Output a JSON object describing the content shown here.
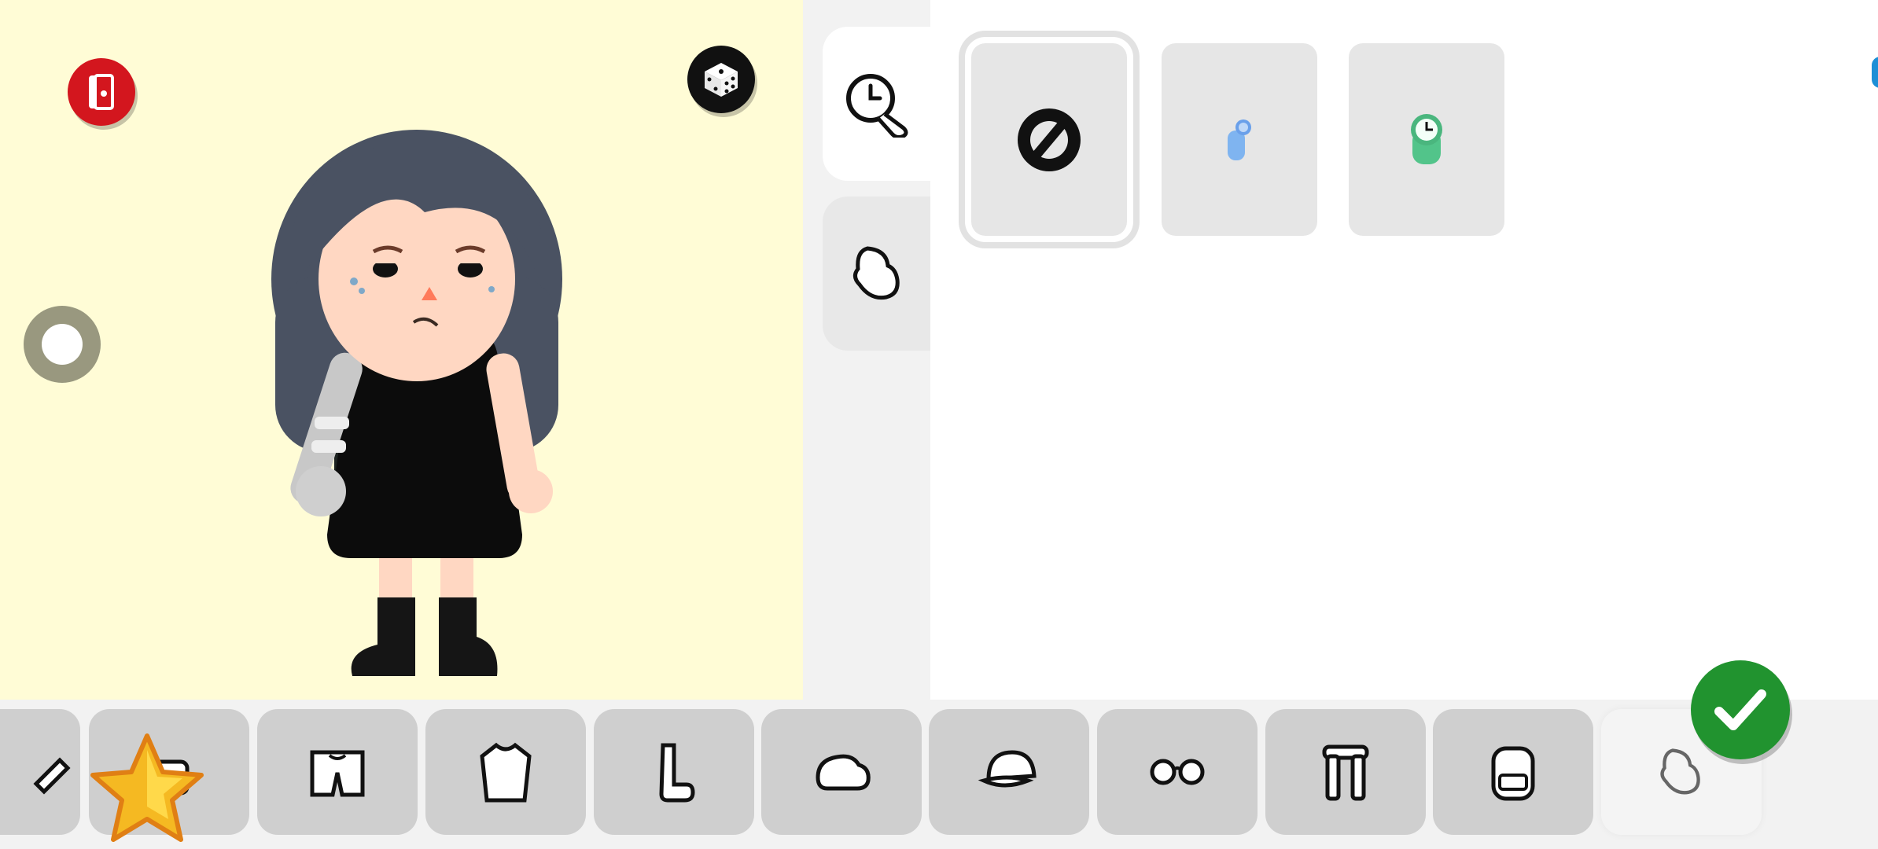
{
  "preview": {
    "background": "#fffcd6",
    "exit_icon": "exit-door-icon",
    "random_icon": "dice-icon",
    "rotate_control": "rotate-handle"
  },
  "category_tabs": [
    {
      "icon": "watch-icon",
      "active": true
    },
    {
      "icon": "glove-icon",
      "active": false
    }
  ],
  "items": [
    {
      "icon": "none-icon",
      "selected": true
    },
    {
      "icon": "blue-watch-icon",
      "selected": false
    },
    {
      "icon": "green-watch-icon",
      "selected": false
    }
  ],
  "toolbar": {
    "tabs": [
      {
        "icon": "brush-icon"
      },
      {
        "icon": "bag-icon"
      },
      {
        "icon": "shorts-icon"
      },
      {
        "icon": "shirt-icon"
      },
      {
        "icon": "sock-icon"
      },
      {
        "icon": "shoe-icon"
      },
      {
        "icon": "cap-icon"
      },
      {
        "icon": "glasses-icon"
      },
      {
        "icon": "scarf-icon"
      },
      {
        "icon": "backpack-icon"
      },
      {
        "icon": "glove-icon",
        "active": true
      }
    ],
    "favorites_icon": "star-icon",
    "confirm_icon": "checkmark-icon"
  },
  "colors": {
    "exit": "#d3161e",
    "confirm": "#21932f",
    "tab": "#cfcfcf",
    "accent_blue": "#1d8fd6"
  }
}
